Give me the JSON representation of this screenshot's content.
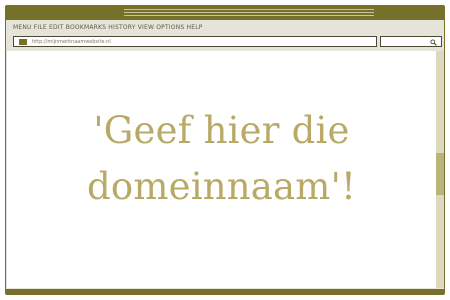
{
  "browser": {
    "menu_text": "MENU FILE EDIT BOOKMARKS HISTORY VIEW OPTIONS HELP",
    "url": "http://mijnmerknaamwebsite.nl"
  },
  "page": {
    "headline_line1": "'Geef hier die",
    "headline_line2": "domeinnaam'!"
  },
  "colors": {
    "chrome": "#77702a",
    "accent_text": "#b8aa66"
  },
  "icons": {
    "favicon": "square-icon",
    "search": "search-icon"
  }
}
